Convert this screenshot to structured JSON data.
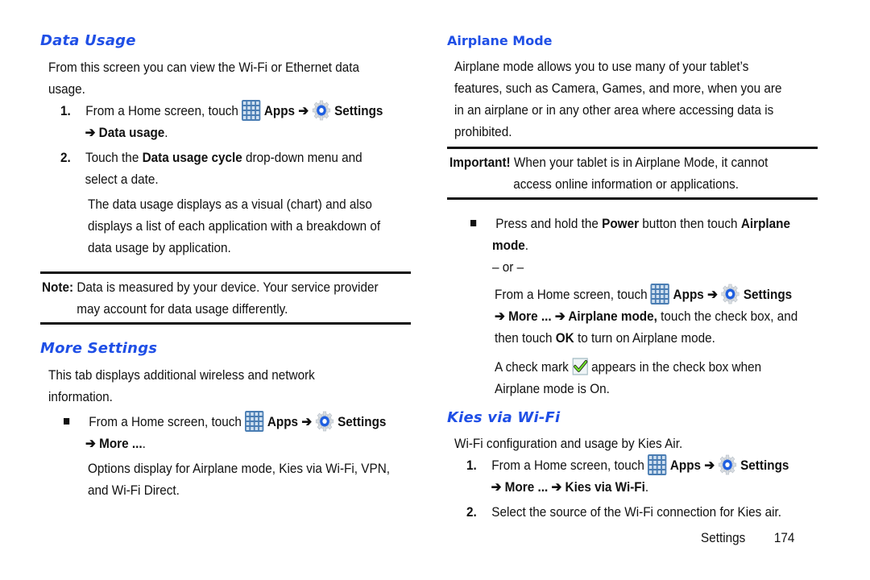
{
  "left": {
    "data_usage": {
      "title": "Data Usage",
      "intro_1": "From this screen you can view the Wi-Fi or Ethernet data",
      "intro_2": "usage.",
      "step1": {
        "num": "1.",
        "pre": "From a Home screen, touch",
        "apps": "Apps",
        "arrow": "➔",
        "settings": "Settings",
        "line2": "➔ Data usage",
        "line2_end": "."
      },
      "step2": {
        "num": "2.",
        "pre": "Touch the",
        "bold": "Data usage cycle",
        "post": "drop-down menu and",
        "line2": "select a date."
      },
      "detail_1": "The data usage displays as a visual (chart) and also",
      "detail_2": "displays a list of each application with a breakdown of",
      "detail_3": "data usage by application.",
      "note": {
        "label": "Note:",
        "line1": "Data is measured by your device. Your service provider",
        "line2": "may account for data usage differently."
      }
    },
    "more_settings": {
      "title": "More Settings",
      "intro_1": "This tab displays additional wireless and network",
      "intro_2": "information.",
      "bullet": {
        "pre": "From a Home screen, touch",
        "apps": "Apps",
        "arrow": "➔",
        "settings": "Settings",
        "line2": "➔ More ...",
        "line2_end": "."
      },
      "detail_1": "Options display for Airplane mode, Kies via Wi-Fi, VPN,",
      "detail_2": "and Wi-Fi Direct."
    }
  },
  "right": {
    "airplane": {
      "title": "Airplane Mode",
      "intro_1": "Airplane mode allows you to use many of your tablet’s",
      "intro_2": "features, such as Camera, Games, and more, when you are",
      "intro_3": "in an airplane or in any other area where accessing data is",
      "intro_4": "prohibited.",
      "important": {
        "label": "Important!",
        "line1": "When your tablet is in Airplane Mode, it cannot",
        "line2": "access online information or applications."
      },
      "bullet": {
        "pre": "Press and hold the",
        "power": "Power",
        "mid": "button then touch",
        "bold_end": "Airplane",
        "line2": "mode",
        "line2_end": "."
      },
      "or": "– or –",
      "alt": {
        "pre": "From a Home screen, touch",
        "apps": "Apps",
        "arrow": "➔",
        "settings": "Settings",
        "line2_bold": "➔ More ... ➔ Airplane mode,",
        "line2_post": "touch the check box, and",
        "line3_pre": "then touch",
        "line3_ok": "OK",
        "line3_post": "to turn on Airplane mode."
      },
      "check_1_pre": "A check mark",
      "check_1_post": "appears in the check box when",
      "check_2": "Airplane mode is On."
    },
    "kies": {
      "title": "Kies via Wi-Fi",
      "intro": "Wi-Fi configuration and usage by Kies Air.",
      "step1": {
        "num": "1.",
        "pre": "From a Home screen, touch",
        "apps": "Apps",
        "arrow": "➔",
        "settings": "Settings",
        "line2": "➔ More ... ➔ Kies via Wi-Fi",
        "line2_end": "."
      },
      "step2": {
        "num": "2.",
        "text": "Select the source of the Wi-Fi connection for Kies air."
      }
    }
  },
  "footer": {
    "section": "Settings",
    "page": "174"
  },
  "colors": {
    "heading": "#1f4fe6",
    "text": "#111111"
  },
  "icons": {
    "apps": "apps-grid-icon",
    "settings": "settings-gear-icon",
    "check": "checkbox-checked-icon",
    "bullet": "square-bullet-icon"
  }
}
